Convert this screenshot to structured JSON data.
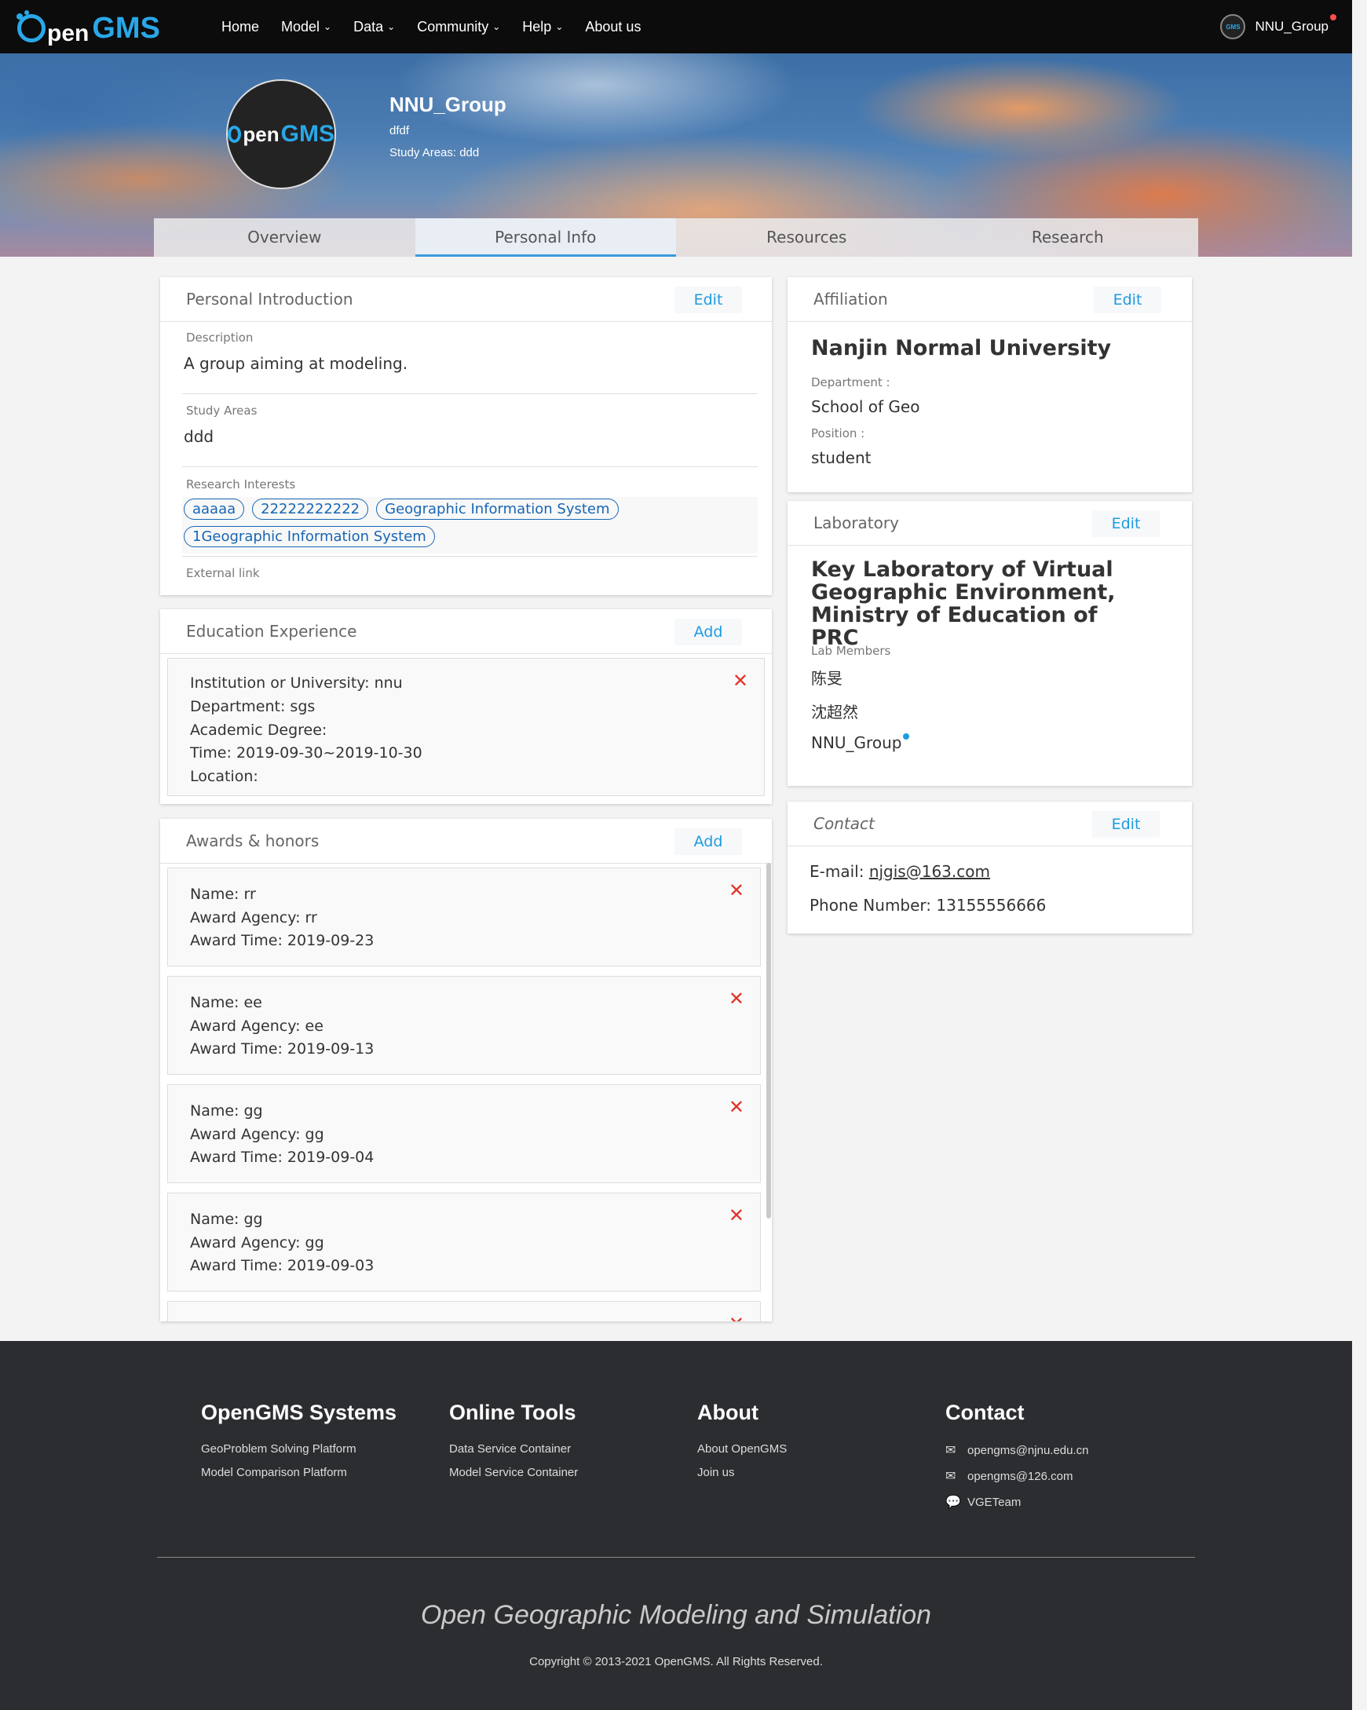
{
  "nav": {
    "brand_o": "O",
    "brand_pen": "pen",
    "brand_gms": "GMS",
    "items": [
      {
        "label": "Home",
        "has_caret": false
      },
      {
        "label": "Model",
        "has_caret": true
      },
      {
        "label": "Data",
        "has_caret": true
      },
      {
        "label": "Community",
        "has_caret": true
      },
      {
        "label": "Help",
        "has_caret": true
      },
      {
        "label": "About us",
        "has_caret": false
      }
    ],
    "caret": "⌄",
    "username": "NNU_Group"
  },
  "profile": {
    "name": "NNU_Group",
    "description": "dfdf",
    "study_areas": "Study Areas: ddd",
    "avatar_pen": "pen",
    "avatar_gms": "GMS"
  },
  "tabs": [
    "Overview",
    "Personal Info",
    "Resources",
    "Research"
  ],
  "active_tab": "Personal Info",
  "personal_intro": {
    "title": "Personal Introduction",
    "edit": "Edit",
    "description_label": "Description",
    "description": "A group aiming at modeling.",
    "study_areas_label": "Study Areas",
    "study_areas": "ddd",
    "research_label": "Research Interests",
    "interests": [
      "aaaaa",
      "22222222222",
      "Geographic Information System",
      "1Geographic Information System"
    ],
    "external_label": "External link"
  },
  "education": {
    "title": "Education Experience",
    "add": "Add",
    "entries": [
      {
        "institution": "Institution or University:   nnu",
        "department": "Department:   sgs",
        "degree": "Academic Degree:",
        "time": "Time:    2019-09-30~2019-10-30",
        "location": "Location:"
      }
    ]
  },
  "awards": {
    "title": "Awards & honors",
    "add": "Add",
    "entries": [
      {
        "name": "Name:   rr",
        "agency": "Award Agency:   rr",
        "time": "Award Time:   2019-09-23"
      },
      {
        "name": "Name:   ee",
        "agency": "Award Agency:   ee",
        "time": "Award Time:   2019-09-13"
      },
      {
        "name": "Name:   gg",
        "agency": "Award Agency:   gg",
        "time": "Award Time:   2019-09-04"
      },
      {
        "name": "Name:   gg",
        "agency": "Award Agency:   gg",
        "time": "Award Time:   2019-09-03"
      }
    ]
  },
  "affiliation": {
    "title": "Affiliation",
    "edit": "Edit",
    "institution": "Nanjin Normal University",
    "department_label": "Department :",
    "department": "School of Geo",
    "position_label": "Position :",
    "position": "student"
  },
  "laboratory": {
    "title": "Laboratory",
    "edit": "Edit",
    "name": "Key Laboratory of Virtual Geographic Environment, Ministry of Education of PRC",
    "members_label": "Lab Members",
    "members": [
      "陈旻",
      "沈超然",
      "NNU_Group"
    ]
  },
  "contact": {
    "title": "Contact",
    "edit": "Edit",
    "email_label": "E-mail: ",
    "email": "njgis@163.com",
    "phone": "Phone Number: 13155556666"
  },
  "footer": {
    "cols": [
      {
        "title": "OpenGMS Systems",
        "links": [
          "GeoProblem Solving Platform",
          "Model Comparison Platform"
        ]
      },
      {
        "title": "Online Tools",
        "links": [
          "Data Service Container",
          "Model Service Container"
        ]
      },
      {
        "title": "About",
        "links": [
          "About OpenGMS",
          "Join us"
        ]
      },
      {
        "title": "Contact",
        "links": [
          "opengms@njnu.edu.cn",
          "opengms@126.com",
          "VGETeam"
        ]
      }
    ],
    "slogan": "Open Geographic Modeling and Simulation",
    "copyright": "Copyright © 2013-2021 OpenGMS. All Rights Reserved."
  },
  "colors": {
    "accent": "#1d9be0",
    "tag_border": "#1766b5",
    "delete": "#e0342b",
    "footer_bg": "#2c2d30",
    "nav_bg": "#0c0c0c"
  },
  "icons": {
    "delete": "✕",
    "mail": "✉",
    "wechat": "💬"
  }
}
